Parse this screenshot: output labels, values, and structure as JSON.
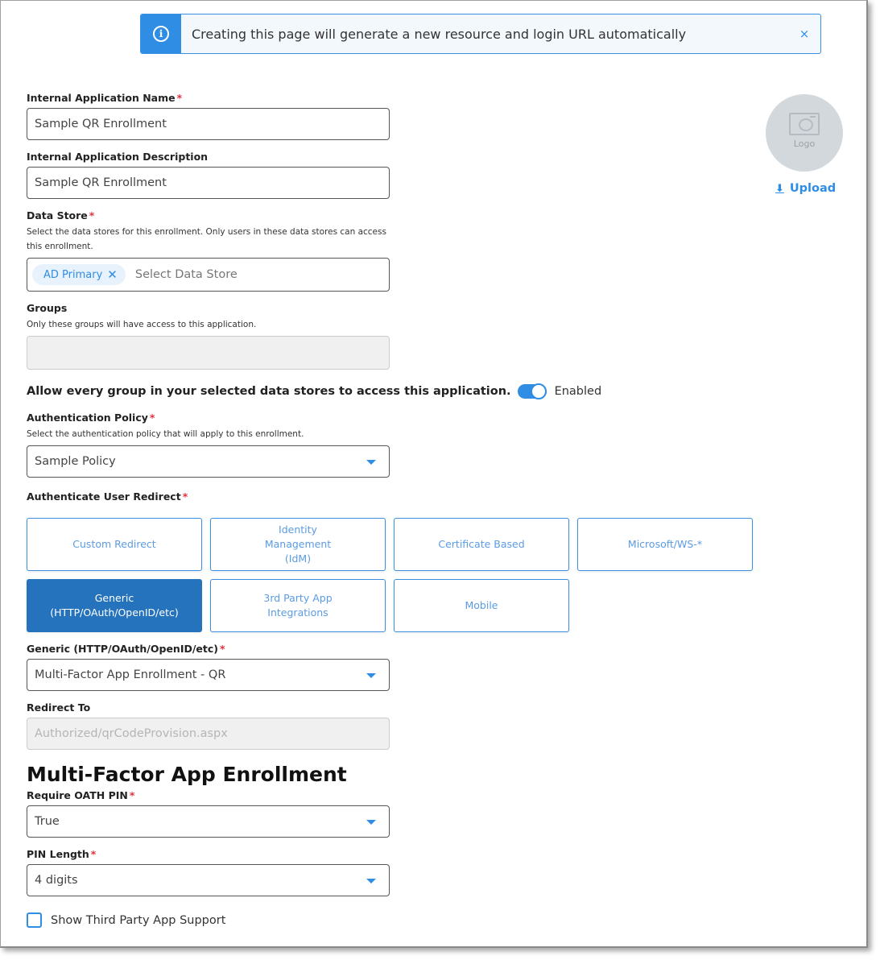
{
  "banner": {
    "icon": "info-icon",
    "message": "Creating this page will generate a new resource and login URL automatically",
    "close": "×"
  },
  "form": {
    "app_name": {
      "label": "Internal Application Name",
      "required": "*",
      "value": "Sample QR Enrollment"
    },
    "app_description": {
      "label": "Internal Application Description",
      "value": "Sample QR Enrollment"
    },
    "data_store": {
      "label": "Data Store",
      "required": "*",
      "help": "Select the data stores for this enrollment. Only users in these data stores can access this enrollment.",
      "chips": [
        {
          "label": "AD Primary",
          "remove": "✕"
        }
      ],
      "placeholder": "Select Data Store"
    },
    "groups": {
      "label": "Groups",
      "help": "Only these groups will have access to this application.",
      "value": ""
    },
    "allow_all_groups": {
      "label": "Allow every group in your selected data stores to access this application.",
      "state": "Enabled",
      "enabled": true
    },
    "auth_policy": {
      "label": "Authentication Policy",
      "required": "*",
      "help": "Select the authentication policy that will apply to this enrollment.",
      "value": "Sample Policy"
    },
    "redirect": {
      "label": "Authenticate User Redirect",
      "required": "*",
      "options": [
        {
          "label": "Custom Redirect",
          "selected": false
        },
        {
          "label": "Identity\nManagement\n(IdM)",
          "selected": false
        },
        {
          "label": "Certificate Based",
          "selected": false
        },
        {
          "label": "Microsoft/WS-*",
          "selected": false
        },
        {
          "label": "Generic\n(HTTP/OAuth/OpenID/etc)",
          "selected": true
        },
        {
          "label": "3rd Party App\nIntegrations",
          "selected": false
        },
        {
          "label": "Mobile",
          "selected": false
        }
      ]
    },
    "generic": {
      "label": "Generic (HTTP/OAuth/OpenID/etc)",
      "required": "*",
      "value": "Multi-Factor App Enrollment - QR"
    },
    "redirect_to": {
      "label": "Redirect To",
      "value": "Authorized/qrCodeProvision.aspx"
    }
  },
  "mfa": {
    "title": "Multi-Factor App Enrollment",
    "require_pin": {
      "label": "Require OATH PIN",
      "required": "*",
      "value": "True"
    },
    "pin_length": {
      "label": "PIN Length",
      "required": "*",
      "value": "4 digits"
    },
    "third_party": {
      "label": "Show Third Party App Support",
      "checked": false
    }
  },
  "logo": {
    "placeholder": "Logo",
    "upload_label": "Upload",
    "upload_icon": "⬇"
  }
}
